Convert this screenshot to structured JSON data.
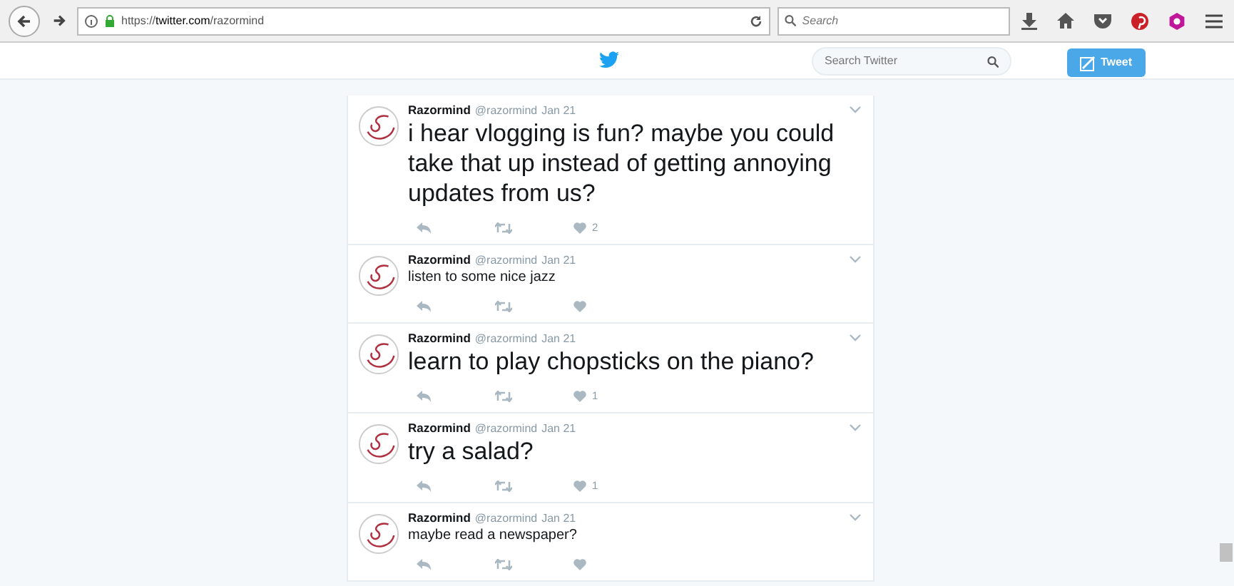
{
  "browser": {
    "url": "https://**twitter.com**/razormind",
    "search": {
      "placeholder": "Search"
    }
  },
  "header": {
    "search": {
      "placeholder": "Search Twitter"
    },
    "tweet_button": "Tweet"
  },
  "tweets": [
    {
      "name": "Razormind",
      "handle": "@razormind",
      "date": "Jan 21",
      "text": "i hear vlogging is fun? maybe you could take that up instead of getting annoying updates from us?",
      "kind": "large",
      "likes": "2"
    },
    {
      "name": "Razormind",
      "handle": "@razormind",
      "date": "Jan 21",
      "text": "listen to some nice jazz",
      "kind": "small"
    },
    {
      "name": "Razormind",
      "handle": "@razormind",
      "date": "Jan 21",
      "text": "learn to play chopsticks on the piano?",
      "kind": "large",
      "likes": "1"
    },
    {
      "name": "Razormind",
      "handle": "@razormind",
      "date": "Jan 21",
      "text": "try a salad?",
      "kind": "large",
      "likes": "1"
    },
    {
      "name": "Razormind",
      "handle": "@razormind",
      "date": "Jan 21",
      "text": "maybe read a newspaper?",
      "kind": "small"
    }
  ]
}
